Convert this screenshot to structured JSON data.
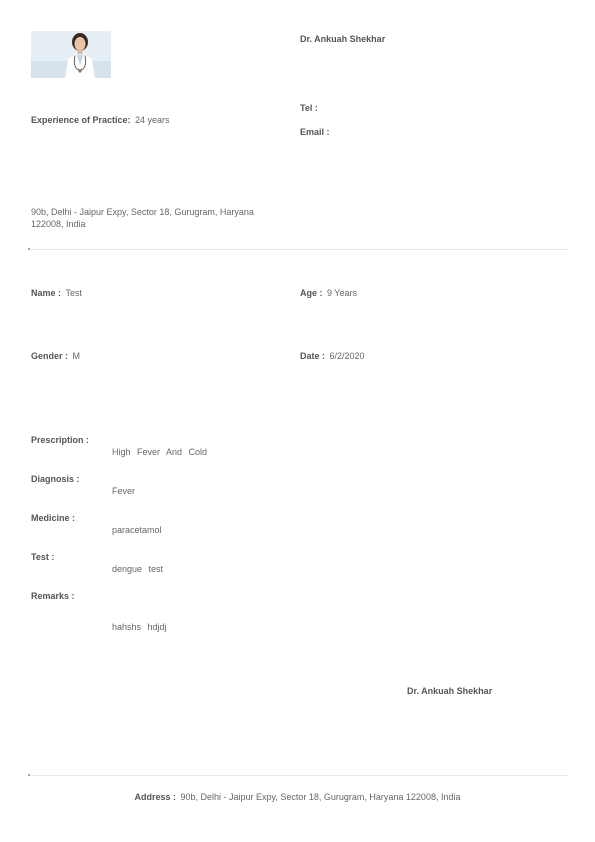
{
  "header": {
    "doctor_name": "Dr. Ankuah Shekhar",
    "experience_label": "Experience of Practice:",
    "experience_value": "24 years",
    "tel_label": "Tel :",
    "tel_value": "",
    "email_label": "Email :",
    "email_value": "",
    "clinic_address_line1": "90b, Delhi - Jaipur Expy, Sector 18, Gurugram, Haryana",
    "clinic_address_line2": "122008, India"
  },
  "patient": {
    "name_label": "Name :",
    "name_value": "Test",
    "age_label": "Age :",
    "age_value": "9 Years",
    "gender_label": "Gender :",
    "gender_value": "M",
    "date_label": "Date :",
    "date_value": "6/2/2020"
  },
  "details": {
    "prescription_label": "Prescription :",
    "prescription_value": "High Fever And Cold",
    "diagnosis_label": "Diagnosis :",
    "diagnosis_value": "Fever",
    "medicine_label": "Medicine :",
    "medicine_value": "paracetamol",
    "test_label": "Test :",
    "test_value": "dengue test",
    "remarks_label": "Remarks :",
    "remarks_value": "hahshs hdjdj"
  },
  "signature": {
    "doctor_name": "Dr. Ankuah Shekhar"
  },
  "footer": {
    "address_label": "Address :",
    "address_value": "90b, Delhi - Jaipur Expy, Sector 18, Gurugram, Haryana 122008, India"
  }
}
